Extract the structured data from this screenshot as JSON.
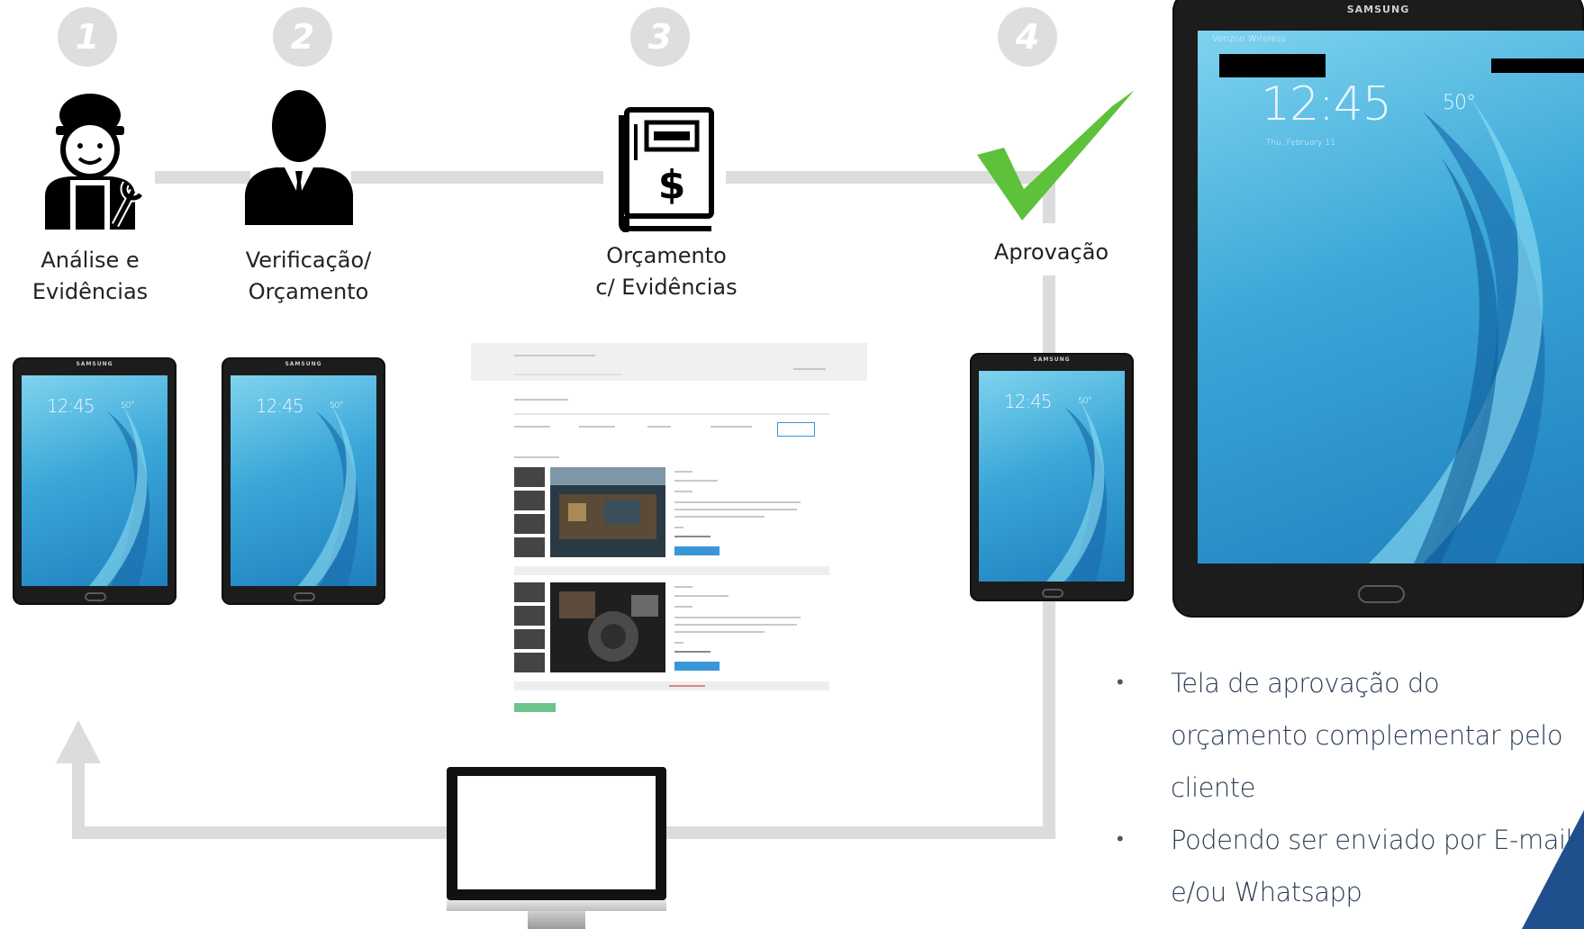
{
  "steps": [
    {
      "number": "1",
      "label_line1": "Análise e",
      "label_line2": "Evidências"
    },
    {
      "number": "2",
      "label_line1": "Verificação/",
      "label_line2": "Orçamento"
    },
    {
      "number": "3",
      "label_line1": "Orçamento",
      "label_line2": "c/ Evidências"
    },
    {
      "number": "4",
      "label_line1": "Aprovação",
      "label_line2": ""
    }
  ],
  "tablet": {
    "brand": "SAMSUNG",
    "clock": "12:45",
    "weather": "50°",
    "carrier": "Verizon Wireless",
    "date": "Thu, February 11"
  },
  "bullets": [
    {
      "text": "Tela de aprovação do orçamento complementar pelo cliente"
    },
    {
      "text": "Podendo ser enviado por E-mail e/ou Whatsapp"
    }
  ],
  "colors": {
    "track": "#dcdcdc",
    "step_circle": "#dedede",
    "check_green": "#5dc13a",
    "screen_blue": "#3aa7d8",
    "bullet_text": "#2c3e55"
  },
  "icons": [
    "mechanic-icon",
    "businessman-icon",
    "price-book-icon",
    "checkmark-icon",
    "monitor-icon"
  ]
}
